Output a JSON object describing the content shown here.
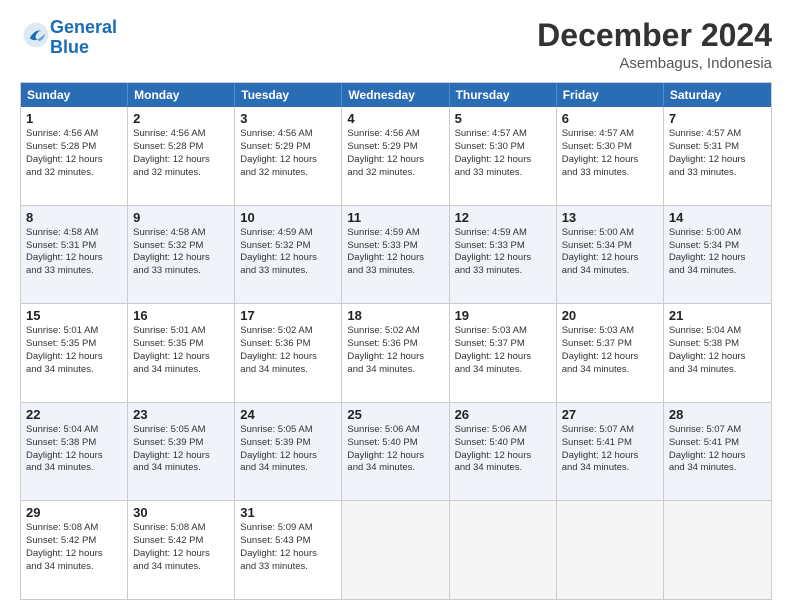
{
  "logo": {
    "text_general": "General",
    "text_blue": "Blue"
  },
  "title": "December 2024",
  "subtitle": "Asembagus, Indonesia",
  "header": {
    "days": [
      "Sunday",
      "Monday",
      "Tuesday",
      "Wednesday",
      "Thursday",
      "Friday",
      "Saturday"
    ]
  },
  "weeks": [
    {
      "alt": false,
      "cells": [
        {
          "day": "1",
          "lines": [
            "Sunrise: 4:56 AM",
            "Sunset: 5:28 PM",
            "Daylight: 12 hours",
            "and 32 minutes."
          ]
        },
        {
          "day": "2",
          "lines": [
            "Sunrise: 4:56 AM",
            "Sunset: 5:28 PM",
            "Daylight: 12 hours",
            "and 32 minutes."
          ]
        },
        {
          "day": "3",
          "lines": [
            "Sunrise: 4:56 AM",
            "Sunset: 5:29 PM",
            "Daylight: 12 hours",
            "and 32 minutes."
          ]
        },
        {
          "day": "4",
          "lines": [
            "Sunrise: 4:56 AM",
            "Sunset: 5:29 PM",
            "Daylight: 12 hours",
            "and 32 minutes."
          ]
        },
        {
          "day": "5",
          "lines": [
            "Sunrise: 4:57 AM",
            "Sunset: 5:30 PM",
            "Daylight: 12 hours",
            "and 33 minutes."
          ]
        },
        {
          "day": "6",
          "lines": [
            "Sunrise: 4:57 AM",
            "Sunset: 5:30 PM",
            "Daylight: 12 hours",
            "and 33 minutes."
          ]
        },
        {
          "day": "7",
          "lines": [
            "Sunrise: 4:57 AM",
            "Sunset: 5:31 PM",
            "Daylight: 12 hours",
            "and 33 minutes."
          ]
        }
      ]
    },
    {
      "alt": true,
      "cells": [
        {
          "day": "8",
          "lines": [
            "Sunrise: 4:58 AM",
            "Sunset: 5:31 PM",
            "Daylight: 12 hours",
            "and 33 minutes."
          ]
        },
        {
          "day": "9",
          "lines": [
            "Sunrise: 4:58 AM",
            "Sunset: 5:32 PM",
            "Daylight: 12 hours",
            "and 33 minutes."
          ]
        },
        {
          "day": "10",
          "lines": [
            "Sunrise: 4:59 AM",
            "Sunset: 5:32 PM",
            "Daylight: 12 hours",
            "and 33 minutes."
          ]
        },
        {
          "day": "11",
          "lines": [
            "Sunrise: 4:59 AM",
            "Sunset: 5:33 PM",
            "Daylight: 12 hours",
            "and 33 minutes."
          ]
        },
        {
          "day": "12",
          "lines": [
            "Sunrise: 4:59 AM",
            "Sunset: 5:33 PM",
            "Daylight: 12 hours",
            "and 33 minutes."
          ]
        },
        {
          "day": "13",
          "lines": [
            "Sunrise: 5:00 AM",
            "Sunset: 5:34 PM",
            "Daylight: 12 hours",
            "and 34 minutes."
          ]
        },
        {
          "day": "14",
          "lines": [
            "Sunrise: 5:00 AM",
            "Sunset: 5:34 PM",
            "Daylight: 12 hours",
            "and 34 minutes."
          ]
        }
      ]
    },
    {
      "alt": false,
      "cells": [
        {
          "day": "15",
          "lines": [
            "Sunrise: 5:01 AM",
            "Sunset: 5:35 PM",
            "Daylight: 12 hours",
            "and 34 minutes."
          ]
        },
        {
          "day": "16",
          "lines": [
            "Sunrise: 5:01 AM",
            "Sunset: 5:35 PM",
            "Daylight: 12 hours",
            "and 34 minutes."
          ]
        },
        {
          "day": "17",
          "lines": [
            "Sunrise: 5:02 AM",
            "Sunset: 5:36 PM",
            "Daylight: 12 hours",
            "and 34 minutes."
          ]
        },
        {
          "day": "18",
          "lines": [
            "Sunrise: 5:02 AM",
            "Sunset: 5:36 PM",
            "Daylight: 12 hours",
            "and 34 minutes."
          ]
        },
        {
          "day": "19",
          "lines": [
            "Sunrise: 5:03 AM",
            "Sunset: 5:37 PM",
            "Daylight: 12 hours",
            "and 34 minutes."
          ]
        },
        {
          "day": "20",
          "lines": [
            "Sunrise: 5:03 AM",
            "Sunset: 5:37 PM",
            "Daylight: 12 hours",
            "and 34 minutes."
          ]
        },
        {
          "day": "21",
          "lines": [
            "Sunrise: 5:04 AM",
            "Sunset: 5:38 PM",
            "Daylight: 12 hours",
            "and 34 minutes."
          ]
        }
      ]
    },
    {
      "alt": true,
      "cells": [
        {
          "day": "22",
          "lines": [
            "Sunrise: 5:04 AM",
            "Sunset: 5:38 PM",
            "Daylight: 12 hours",
            "and 34 minutes."
          ]
        },
        {
          "day": "23",
          "lines": [
            "Sunrise: 5:05 AM",
            "Sunset: 5:39 PM",
            "Daylight: 12 hours",
            "and 34 minutes."
          ]
        },
        {
          "day": "24",
          "lines": [
            "Sunrise: 5:05 AM",
            "Sunset: 5:39 PM",
            "Daylight: 12 hours",
            "and 34 minutes."
          ]
        },
        {
          "day": "25",
          "lines": [
            "Sunrise: 5:06 AM",
            "Sunset: 5:40 PM",
            "Daylight: 12 hours",
            "and 34 minutes."
          ]
        },
        {
          "day": "26",
          "lines": [
            "Sunrise: 5:06 AM",
            "Sunset: 5:40 PM",
            "Daylight: 12 hours",
            "and 34 minutes."
          ]
        },
        {
          "day": "27",
          "lines": [
            "Sunrise: 5:07 AM",
            "Sunset: 5:41 PM",
            "Daylight: 12 hours",
            "and 34 minutes."
          ]
        },
        {
          "day": "28",
          "lines": [
            "Sunrise: 5:07 AM",
            "Sunset: 5:41 PM",
            "Daylight: 12 hours",
            "and 34 minutes."
          ]
        }
      ]
    },
    {
      "alt": false,
      "cells": [
        {
          "day": "29",
          "lines": [
            "Sunrise: 5:08 AM",
            "Sunset: 5:42 PM",
            "Daylight: 12 hours",
            "and 34 minutes."
          ]
        },
        {
          "day": "30",
          "lines": [
            "Sunrise: 5:08 AM",
            "Sunset: 5:42 PM",
            "Daylight: 12 hours",
            "and 34 minutes."
          ]
        },
        {
          "day": "31",
          "lines": [
            "Sunrise: 5:09 AM",
            "Sunset: 5:43 PM",
            "Daylight: 12 hours",
            "and 33 minutes."
          ]
        },
        {
          "day": "",
          "lines": []
        },
        {
          "day": "",
          "lines": []
        },
        {
          "day": "",
          "lines": []
        },
        {
          "day": "",
          "lines": []
        }
      ]
    }
  ]
}
